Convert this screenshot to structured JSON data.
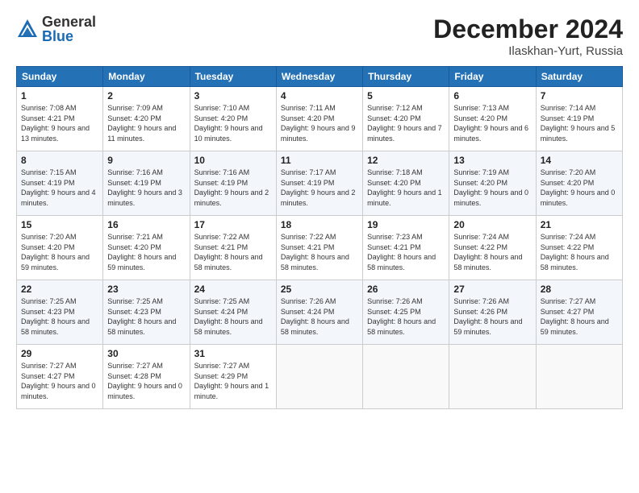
{
  "header": {
    "logo_general": "General",
    "logo_blue": "Blue",
    "month": "December 2024",
    "location": "Ilaskhan-Yurt, Russia"
  },
  "days_of_week": [
    "Sunday",
    "Monday",
    "Tuesday",
    "Wednesday",
    "Thursday",
    "Friday",
    "Saturday"
  ],
  "weeks": [
    [
      {
        "day": "1",
        "sunrise": "Sunrise: 7:08 AM",
        "sunset": "Sunset: 4:21 PM",
        "daylight": "Daylight: 9 hours and 13 minutes."
      },
      {
        "day": "2",
        "sunrise": "Sunrise: 7:09 AM",
        "sunset": "Sunset: 4:20 PM",
        "daylight": "Daylight: 9 hours and 11 minutes."
      },
      {
        "day": "3",
        "sunrise": "Sunrise: 7:10 AM",
        "sunset": "Sunset: 4:20 PM",
        "daylight": "Daylight: 9 hours and 10 minutes."
      },
      {
        "day": "4",
        "sunrise": "Sunrise: 7:11 AM",
        "sunset": "Sunset: 4:20 PM",
        "daylight": "Daylight: 9 hours and 9 minutes."
      },
      {
        "day": "5",
        "sunrise": "Sunrise: 7:12 AM",
        "sunset": "Sunset: 4:20 PM",
        "daylight": "Daylight: 9 hours and 7 minutes."
      },
      {
        "day": "6",
        "sunrise": "Sunrise: 7:13 AM",
        "sunset": "Sunset: 4:20 PM",
        "daylight": "Daylight: 9 hours and 6 minutes."
      },
      {
        "day": "7",
        "sunrise": "Sunrise: 7:14 AM",
        "sunset": "Sunset: 4:19 PM",
        "daylight": "Daylight: 9 hours and 5 minutes."
      }
    ],
    [
      {
        "day": "8",
        "sunrise": "Sunrise: 7:15 AM",
        "sunset": "Sunset: 4:19 PM",
        "daylight": "Daylight: 9 hours and 4 minutes."
      },
      {
        "day": "9",
        "sunrise": "Sunrise: 7:16 AM",
        "sunset": "Sunset: 4:19 PM",
        "daylight": "Daylight: 9 hours and 3 minutes."
      },
      {
        "day": "10",
        "sunrise": "Sunrise: 7:16 AM",
        "sunset": "Sunset: 4:19 PM",
        "daylight": "Daylight: 9 hours and 2 minutes."
      },
      {
        "day": "11",
        "sunrise": "Sunrise: 7:17 AM",
        "sunset": "Sunset: 4:19 PM",
        "daylight": "Daylight: 9 hours and 2 minutes."
      },
      {
        "day": "12",
        "sunrise": "Sunrise: 7:18 AM",
        "sunset": "Sunset: 4:20 PM",
        "daylight": "Daylight: 9 hours and 1 minute."
      },
      {
        "day": "13",
        "sunrise": "Sunrise: 7:19 AM",
        "sunset": "Sunset: 4:20 PM",
        "daylight": "Daylight: 9 hours and 0 minutes."
      },
      {
        "day": "14",
        "sunrise": "Sunrise: 7:20 AM",
        "sunset": "Sunset: 4:20 PM",
        "daylight": "Daylight: 9 hours and 0 minutes."
      }
    ],
    [
      {
        "day": "15",
        "sunrise": "Sunrise: 7:20 AM",
        "sunset": "Sunset: 4:20 PM",
        "daylight": "Daylight: 8 hours and 59 minutes."
      },
      {
        "day": "16",
        "sunrise": "Sunrise: 7:21 AM",
        "sunset": "Sunset: 4:20 PM",
        "daylight": "Daylight: 8 hours and 59 minutes."
      },
      {
        "day": "17",
        "sunrise": "Sunrise: 7:22 AM",
        "sunset": "Sunset: 4:21 PM",
        "daylight": "Daylight: 8 hours and 58 minutes."
      },
      {
        "day": "18",
        "sunrise": "Sunrise: 7:22 AM",
        "sunset": "Sunset: 4:21 PM",
        "daylight": "Daylight: 8 hours and 58 minutes."
      },
      {
        "day": "19",
        "sunrise": "Sunrise: 7:23 AM",
        "sunset": "Sunset: 4:21 PM",
        "daylight": "Daylight: 8 hours and 58 minutes."
      },
      {
        "day": "20",
        "sunrise": "Sunrise: 7:24 AM",
        "sunset": "Sunset: 4:22 PM",
        "daylight": "Daylight: 8 hours and 58 minutes."
      },
      {
        "day": "21",
        "sunrise": "Sunrise: 7:24 AM",
        "sunset": "Sunset: 4:22 PM",
        "daylight": "Daylight: 8 hours and 58 minutes."
      }
    ],
    [
      {
        "day": "22",
        "sunrise": "Sunrise: 7:25 AM",
        "sunset": "Sunset: 4:23 PM",
        "daylight": "Daylight: 8 hours and 58 minutes."
      },
      {
        "day": "23",
        "sunrise": "Sunrise: 7:25 AM",
        "sunset": "Sunset: 4:23 PM",
        "daylight": "Daylight: 8 hours and 58 minutes."
      },
      {
        "day": "24",
        "sunrise": "Sunrise: 7:25 AM",
        "sunset": "Sunset: 4:24 PM",
        "daylight": "Daylight: 8 hours and 58 minutes."
      },
      {
        "day": "25",
        "sunrise": "Sunrise: 7:26 AM",
        "sunset": "Sunset: 4:24 PM",
        "daylight": "Daylight: 8 hours and 58 minutes."
      },
      {
        "day": "26",
        "sunrise": "Sunrise: 7:26 AM",
        "sunset": "Sunset: 4:25 PM",
        "daylight": "Daylight: 8 hours and 58 minutes."
      },
      {
        "day": "27",
        "sunrise": "Sunrise: 7:26 AM",
        "sunset": "Sunset: 4:26 PM",
        "daylight": "Daylight: 8 hours and 59 minutes."
      },
      {
        "day": "28",
        "sunrise": "Sunrise: 7:27 AM",
        "sunset": "Sunset: 4:27 PM",
        "daylight": "Daylight: 8 hours and 59 minutes."
      }
    ],
    [
      {
        "day": "29",
        "sunrise": "Sunrise: 7:27 AM",
        "sunset": "Sunset: 4:27 PM",
        "daylight": "Daylight: 9 hours and 0 minutes."
      },
      {
        "day": "30",
        "sunrise": "Sunrise: 7:27 AM",
        "sunset": "Sunset: 4:28 PM",
        "daylight": "Daylight: 9 hours and 0 minutes."
      },
      {
        "day": "31",
        "sunrise": "Sunrise: 7:27 AM",
        "sunset": "Sunset: 4:29 PM",
        "daylight": "Daylight: 9 hours and 1 minute."
      },
      {
        "day": "",
        "sunrise": "",
        "sunset": "",
        "daylight": ""
      },
      {
        "day": "",
        "sunrise": "",
        "sunset": "",
        "daylight": ""
      },
      {
        "day": "",
        "sunrise": "",
        "sunset": "",
        "daylight": ""
      },
      {
        "day": "",
        "sunrise": "",
        "sunset": "",
        "daylight": ""
      }
    ]
  ]
}
